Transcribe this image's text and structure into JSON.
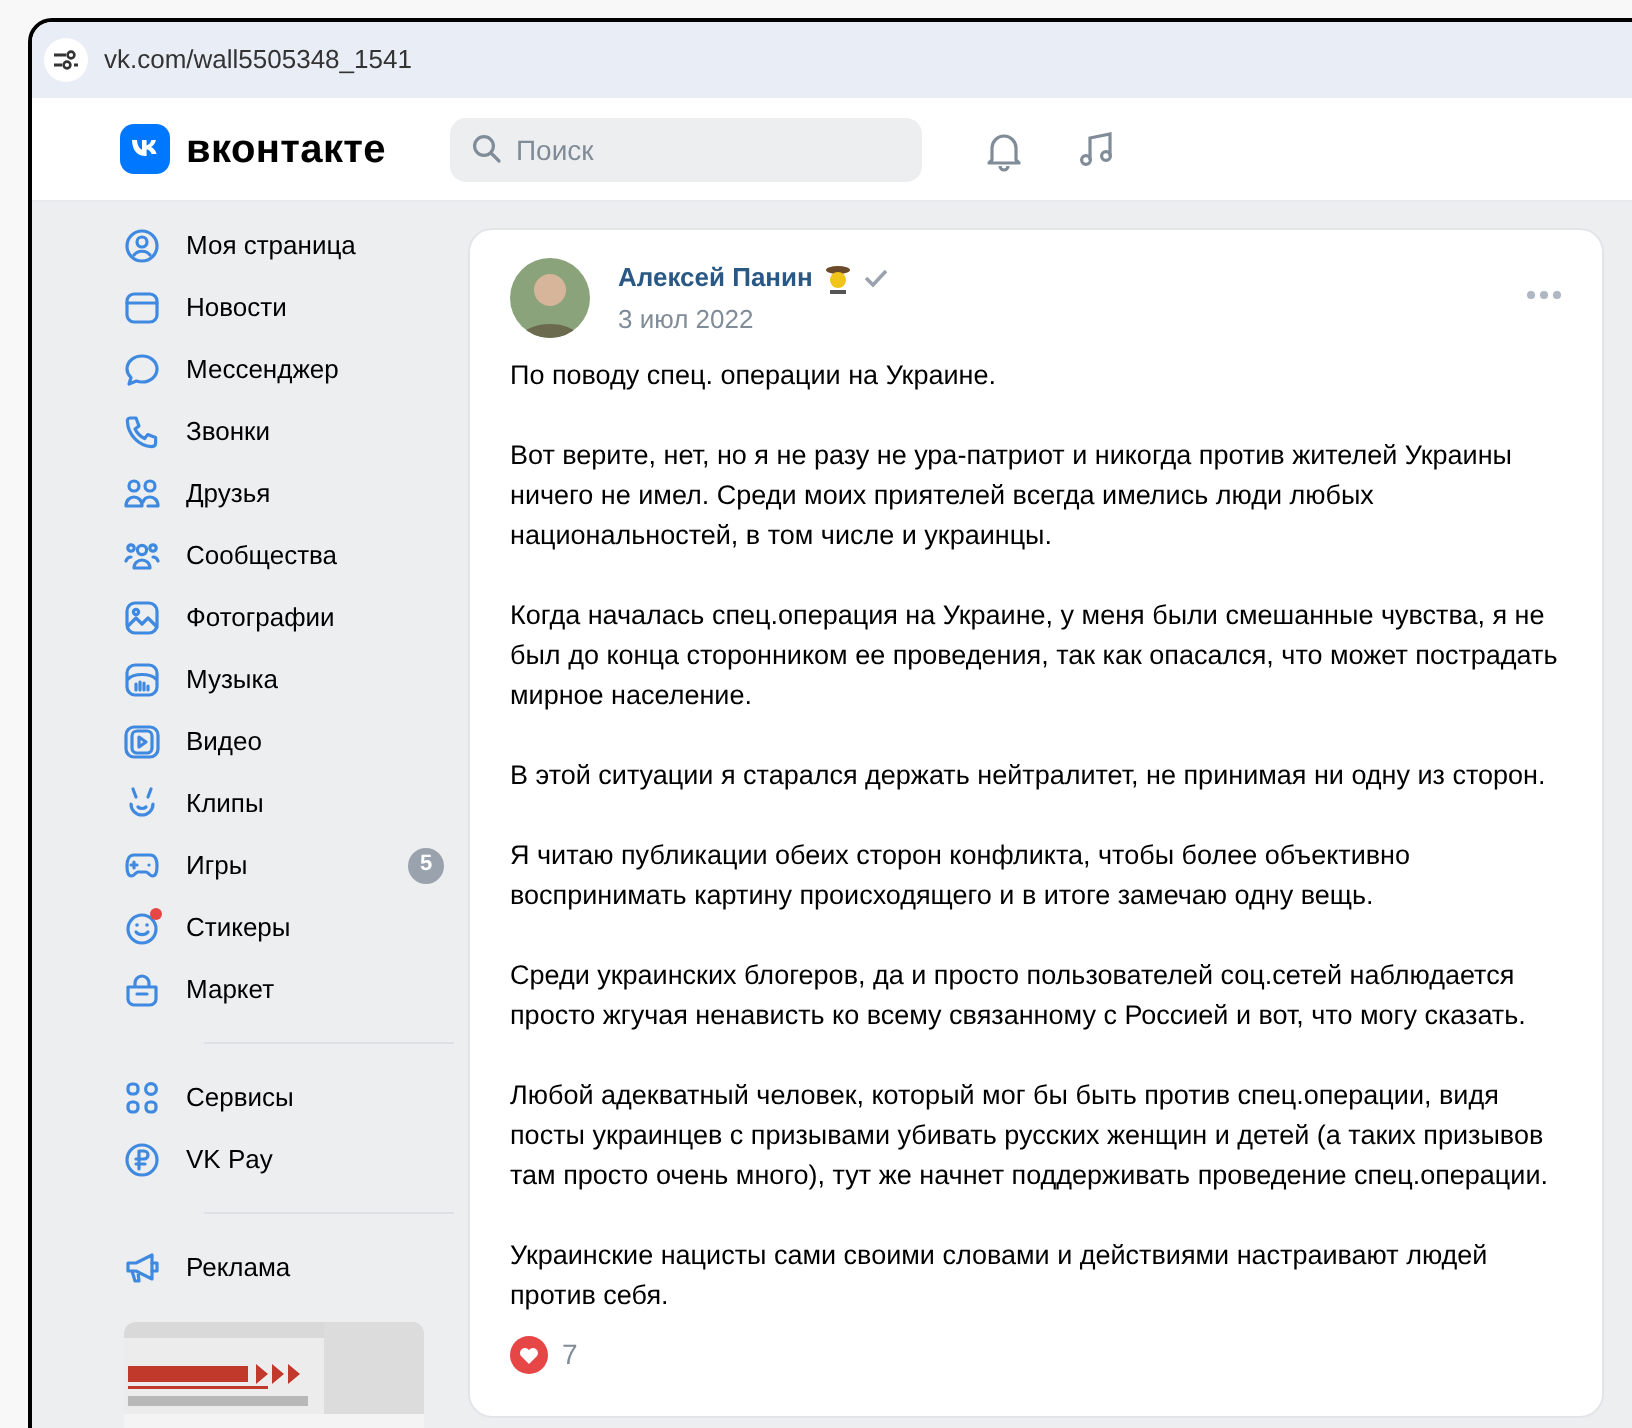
{
  "browser": {
    "url": "vk.com/wall5505348_1541"
  },
  "header": {
    "logo_text": "вконтакте",
    "search": {
      "placeholder": "Поиск"
    }
  },
  "sidebar": {
    "sections": [
      {
        "items": [
          {
            "label": "Моя страница",
            "alert": false
          },
          {
            "label": "Новости",
            "alert": false
          },
          {
            "label": "Мессенджер",
            "alert": false
          },
          {
            "label": "Звонки",
            "alert": false
          },
          {
            "label": "Друзья",
            "alert": false
          },
          {
            "label": "Сообщества",
            "alert": false
          },
          {
            "label": "Фотографии",
            "alert": false
          },
          {
            "label": "Музыка",
            "alert": false
          },
          {
            "label": "Видео",
            "alert": false
          },
          {
            "label": "Клипы",
            "alert": false
          },
          {
            "label": "Игры",
            "alert": false,
            "badge": "5"
          },
          {
            "label": "Стикеры",
            "alert": true
          },
          {
            "label": "Маркет",
            "alert": false
          }
        ]
      },
      {
        "items": [
          {
            "label": "Сервисы",
            "alert": false
          },
          {
            "label": "VK Pay",
            "alert": false
          }
        ]
      },
      {
        "items": [
          {
            "label": "Реклама",
            "alert": false
          }
        ]
      }
    ]
  },
  "post": {
    "author": "Алексей Панин",
    "verified": true,
    "date": "3 июл 2022",
    "paragraphs": [
      "По поводу спец. операции на Украине.",
      "Вот верите, нет, но я не разу не ура-патриот и никогда против жителей Украины ничего не имел. Среди моих приятелей всегда имелись люди любых национальностей, в том числе и украинцы.",
      "Когда началась спец.операция на Украине, у меня были смешанные чувства, я не был до конца сторонником ее проведения, так как опасался, что может пострадать мирное население.",
      "В этой ситуации я старался держать нейтралитет, не принимая ни одну из сторон.",
      "Я читаю публикации обеих сторон конфликта, чтобы более объективно воспринимать картину происходящего и в итоге замечаю одну вещь.",
      "Среди украинских блогеров, да и просто пользователей соц.сетей наблюдается просто жгучая ненависть ко всему связанному с Россией и вот, что могу сказать.",
      "Любой адекватный человек, который мог бы быть против спец.операции, видя посты украинцев с призывами убивать русских женщин и детей (а таких призывов там просто очень много), тут же начнет поддерживать проведение спец.операции.",
      "Украинские нацисты сами своими словами и действиями настраивают людей против себя."
    ],
    "likes": {
      "count": "7",
      "liked": true
    }
  }
}
